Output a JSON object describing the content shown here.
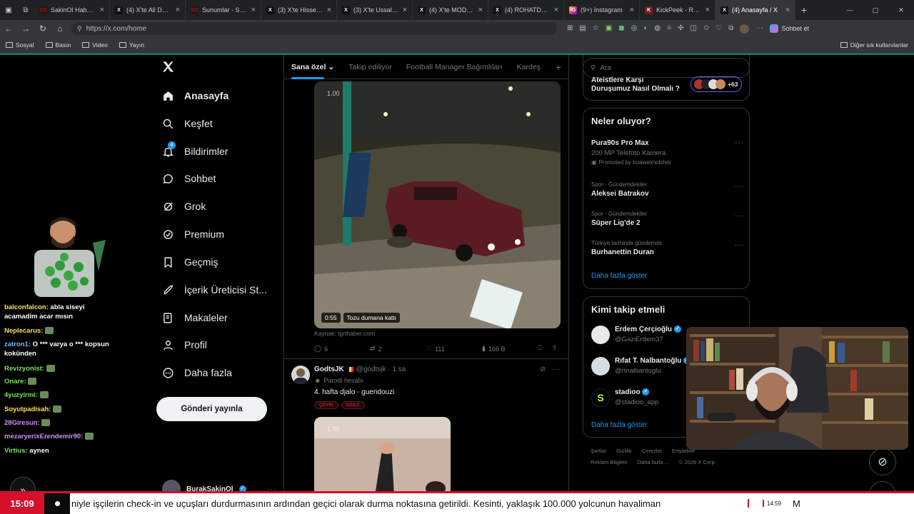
{
  "browser": {
    "tabs": [
      {
        "title": "SakinOl Haber Merk",
        "favicon": "SO",
        "active": false
      },
      {
        "title": "(4) X'te Ali Deniz Ça",
        "favicon": "X",
        "active": false
      },
      {
        "title": "Sunumlar - SakinOl",
        "favicon": "SO",
        "active": false
      },
      {
        "title": "(3) X'te Hisse Parafe",
        "favicon": "X",
        "active": false
      },
      {
        "title": "(3) X'te Ussal Sahbal",
        "favicon": "X",
        "active": false
      },
      {
        "title": "(4) X'te MOD: \"\"MEI",
        "favicon": "X",
        "active": false
      },
      {
        "title": "(4) ROHATDEMIR (@",
        "favicon": "X",
        "active": false
      },
      {
        "title": "(9+) Instagram",
        "favicon": "IG",
        "active": false
      },
      {
        "title": "KickPeek - Real-tim",
        "favicon": "K",
        "active": false
      },
      {
        "title": "(4) Anasayfa / X",
        "favicon": "X",
        "active": true
      }
    ],
    "url": "https://x.com/home",
    "sohbet_label": "Sohbet et",
    "bookmarks": [
      "Sosyal",
      "Basın",
      "Video",
      "Yayın"
    ],
    "other_bookmarks": "Diğer sık kullanılanlar"
  },
  "sidebar": {
    "items": [
      {
        "label": "Anasayfa",
        "icon": "home-icon"
      },
      {
        "label": "Keşfet",
        "icon": "search-icon"
      },
      {
        "label": "Bildirimler",
        "icon": "bell-icon",
        "badge": "4"
      },
      {
        "label": "Sohbet",
        "icon": "chat-icon"
      },
      {
        "label": "Grok",
        "icon": "grok-icon"
      },
      {
        "label": "Premium",
        "icon": "premium-icon"
      },
      {
        "label": "Geçmiş",
        "icon": "bookmark-icon"
      },
      {
        "label": "İçerik Üreticisi St...",
        "icon": "rocket-icon"
      },
      {
        "label": "Makaleler",
        "icon": "article-icon"
      },
      {
        "label": "Profil",
        "icon": "person-icon"
      },
      {
        "label": "Daha fazla",
        "icon": "more-circle-icon"
      }
    ],
    "post_button": "Gönderi yayınla",
    "account_name": "BurakSakinOl"
  },
  "feed": {
    "tabs": [
      "Sana özel",
      "Takip ediliyor",
      "Football Manager Bağımlıları",
      "Kardeş"
    ],
    "tweet1": {
      "zoom": "1.00",
      "duration": "0:55",
      "caption": "Tozu dumana kattı",
      "source": "Kaynak: tgrthaber.com",
      "replies": "6",
      "retweets": "2",
      "likes": "111",
      "views": "166 B"
    },
    "tweet2": {
      "name": "GodtsJK",
      "handle": "@godtsjk · 1 sa",
      "label": "Parodi hesabı",
      "text": "4. hafta djalo - guendouzi",
      "pills": [
        "ÇEVİR",
        "DİNLE"
      ],
      "zoom": "1.00"
    }
  },
  "right": {
    "search_placeholder": "Ara",
    "space_title_1": "Ateistlere Karşı",
    "space_title_2": "Duruşumuz Nasıl Olmalı ?",
    "space_count": "+63",
    "trends_title": "Neler oluyor?",
    "trends": [
      {
        "category": "",
        "name": "Pura90s Pro Max",
        "sub": "200 MP Telefoto Kamera",
        "promo": "Promoted by huaweimobiletr"
      },
      {
        "category": "Spor · Gündemdekiler",
        "name": "Aleksei Batrakov"
      },
      {
        "category": "Spor · Gündemdekiler",
        "name": "Süper Lig'de 2"
      },
      {
        "category": "Türkiye tarihinde gündemde",
        "name": "Burhanettin Duran"
      }
    ],
    "trends_more": "Daha fazla göster",
    "who_title": "Kimi takip etmeli",
    "who": [
      {
        "name": "Erdem Çerçioğlu",
        "handle": "@GaziErdem37"
      },
      {
        "name": "Rıfat T. Nalbantoğlu",
        "handle": "@rtnalbantoglu"
      },
      {
        "name": "stadioo",
        "handle": "@stadioo_app"
      }
    ],
    "who_more": "Daha fazla göster",
    "footer1": [
      "Şartlar",
      "Gizlilik",
      "Çerezler",
      "Erişilebilir"
    ],
    "footer2": [
      "Reklam Bilgileri",
      "Daha fazla ...",
      "© 2026 X Corp."
    ]
  },
  "chat": [
    {
      "user": "balconfalcon:",
      "color": "#ffe14d",
      "text": "abla siseyi acamadim acar mısın"
    },
    {
      "user": "Neplecarus:",
      "color": "#ffe14d",
      "text": ""
    },
    {
      "user": "zatron1:",
      "color": "#7ab8ff",
      "text": "O *** varya o *** kopsun kokünden"
    },
    {
      "user": "Revizyonist:",
      "color": "#7ee05a",
      "text": ""
    },
    {
      "user": "Onare:",
      "color": "#7ee05a",
      "text": ""
    },
    {
      "user": "4yuzyirmi:",
      "color": "#7ee05a",
      "text": ""
    },
    {
      "user": "Soyutpadisah:",
      "color": "#ffe14d",
      "text": ""
    },
    {
      "user": "28Giresun:",
      "color": "#d58cff",
      "text": ""
    },
    {
      "user": "mezaryerixErendemir90:",
      "color": "#d58cff",
      "text": ""
    },
    {
      "user": "Virtius:",
      "color": "#7ee05a",
      "text": "aynen"
    }
  ],
  "ticker": {
    "time": "15:09",
    "text": "niyle işçilerin check-in ve uçuşları durdurmasının ardından geçici olarak durma noktasına getirildi. Kesinti, yaklaşık 100.000 yolcunun havaliman",
    "clock": "14:59",
    "right": "M"
  }
}
